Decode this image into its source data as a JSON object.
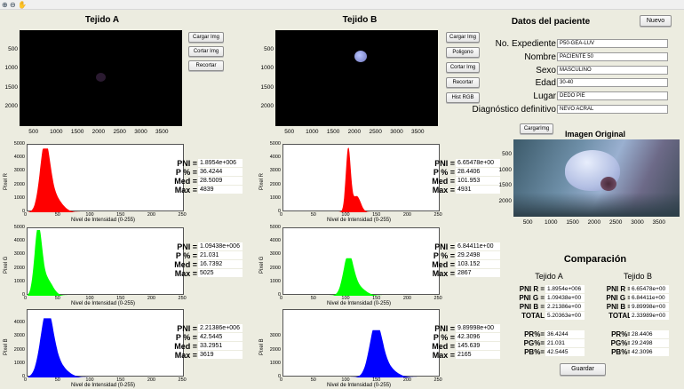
{
  "colors": {
    "red": "#ff0000",
    "green": "#00ff00",
    "blue": "#0000ff"
  },
  "toolbar": {
    "icons": [
      "zoom-in-icon",
      "zoom-out-icon",
      "pan-icon"
    ]
  },
  "tejidoA": {
    "title": "Tejido A",
    "buttons": [
      "Cargar Img",
      "Cortar Img",
      "Recortar"
    ],
    "yticks": [
      "500",
      "1000",
      "1500",
      "2000"
    ],
    "xticks": [
      "500",
      "1000",
      "1500",
      "2000",
      "2500",
      "3000",
      "3500"
    ]
  },
  "tejidoB": {
    "title": "Tejido B",
    "buttons": [
      "Cargar Img",
      "Poligono",
      "Cortar Img",
      "Recortar",
      "Hist RGB"
    ],
    "yticks": [
      "500",
      "1000",
      "1500",
      "2000"
    ],
    "xticks": [
      "500",
      "1000",
      "1500",
      "2000",
      "2500",
      "3000",
      "3500"
    ]
  },
  "histograms": {
    "xlabel": "Nivel de Intensidad (0-255)",
    "xticks": [
      "0",
      "50",
      "100",
      "150",
      "200",
      "250"
    ],
    "A": [
      {
        "ylabel": "Pixel R",
        "yticks": [
          "0",
          "1000",
          "2000",
          "3000",
          "4000",
          "5000"
        ],
        "peak": 27,
        "width": 8,
        "height": 0.97,
        "color": "#ff0000",
        "stats": {
          "l1": "PNI =",
          "v1": "1.8954e+006",
          "l2": "P % =",
          "v2": "36.4244",
          "l3": "Med =",
          "v3": "28.5009",
          "l4": "Max =",
          "v4": "4839"
        }
      },
      {
        "ylabel": "Pixel G",
        "yticks": [
          "0",
          "1000",
          "2000",
          "3000",
          "4000",
          "5000"
        ],
        "peak": 16,
        "width": 6,
        "height": 1.0,
        "color": "#00ff00",
        "stats": {
          "l1": "PNI =",
          "v1": "1.09438e+006",
          "l2": "P % =",
          "v2": "21.031",
          "l3": "Med =",
          "v3": "16.7392",
          "l4": "Max =",
          "v4": "5025"
        }
      },
      {
        "ylabel": "Pixel B",
        "yticks": [
          "0",
          "1000",
          "2000",
          "3000",
          "4000"
        ],
        "peak": 30,
        "width": 10,
        "height": 0.9,
        "color": "#0000ff",
        "stats": {
          "l1": "PNI =",
          "v1": "2.21386e+006",
          "l2": "P % =",
          "v2": "42.5445",
          "l3": "Med =",
          "v3": "33.2951",
          "l4": "Max =",
          "v4": "3619"
        }
      }
    ],
    "B": [
      {
        "ylabel": "Pixel R",
        "yticks": [
          "0",
          "1000",
          "2000",
          "3000",
          "4000",
          "5000"
        ],
        "peak": 105,
        "width": 4,
        "height": 0.98,
        "color": "#ff0000",
        "stats": {
          "l1": "PNI =",
          "v1": "6.65478e+00",
          "l2": "P % =",
          "v2": "28.4406",
          "l3": "Med =",
          "v3": "101.953",
          "l4": "Max =",
          "v4": "4931"
        }
      },
      {
        "ylabel": "Pixel G",
        "yticks": [
          "0",
          "1000",
          "2000",
          "3000",
          "4000",
          "5000"
        ],
        "peak": 105,
        "width": 8,
        "height": 0.57,
        "color": "#00ff00",
        "stats": {
          "l1": "PNI =",
          "v1": "6.84411e+00",
          "l2": "P % =",
          "v2": "29.2498",
          "l3": "Med =",
          "v3": "103.152",
          "l4": "Max =",
          "v4": "2867"
        }
      },
      {
        "ylabel": "Pixel B",
        "yticks": [
          "0",
          "1000",
          "2000",
          "3000"
        ],
        "peak": 150,
        "width": 10,
        "height": 0.72,
        "color": "#0000ff",
        "stats": {
          "l1": "PNI =",
          "v1": "9.89998e+00",
          "l2": "P % =",
          "v2": "42.3096",
          "l3": "Med =",
          "v3": "145.639",
          "l4": "Max =",
          "v4": "2165"
        }
      }
    ]
  },
  "patient": {
    "title": "Datos del paciente",
    "nuevo": "Nuevo",
    "fields": [
      {
        "label": "No. Expediente",
        "value": "P50-GEA-LUV"
      },
      {
        "label": "Nombre",
        "value": "PACIENTE 50"
      },
      {
        "label": "Sexo",
        "value": "MASCULINO"
      },
      {
        "label": "Edad",
        "value": "30-40"
      },
      {
        "label": "Lugar",
        "value": "DEDO PIE"
      },
      {
        "label": "Diagnóstico definitivo",
        "value": "NEVO ACRAL"
      }
    ]
  },
  "original": {
    "button": "CargarImg",
    "title": "Imagen Original",
    "yticks": [
      "500",
      "1000",
      "1500",
      "2000"
    ],
    "xticks": [
      "500",
      "1000",
      "1500",
      "2000",
      "2500",
      "3000",
      "3500"
    ]
  },
  "comparacion": {
    "title": "Comparación",
    "colA": "Tejido A",
    "colB": "Tejido B",
    "rowsA": [
      [
        "PNI R =",
        "1.8954e+006"
      ],
      [
        "PNI G =",
        "1.09438e+00"
      ],
      [
        "PNI B =",
        "2.21386e+00"
      ],
      [
        "TOTAL",
        "5.20363e+00"
      ]
    ],
    "rowsB": [
      [
        "PNI R =",
        "6.65478e+00"
      ],
      [
        "PNI G =",
        "6.84411e+00"
      ],
      [
        "PNI B =",
        "9.89998e+00"
      ],
      [
        "TOTAL",
        "2.33989e+00"
      ]
    ],
    "prA": [
      [
        "PR%=",
        "36.4244"
      ],
      [
        "PG%=",
        "21.031"
      ],
      [
        "PB%=",
        "42.5445"
      ]
    ],
    "prB": [
      [
        "PR%=",
        "28.4406"
      ],
      [
        "PG%=",
        "29.2498"
      ],
      [
        "PB%=",
        "42.3096"
      ]
    ],
    "guardar": "Guardar"
  }
}
